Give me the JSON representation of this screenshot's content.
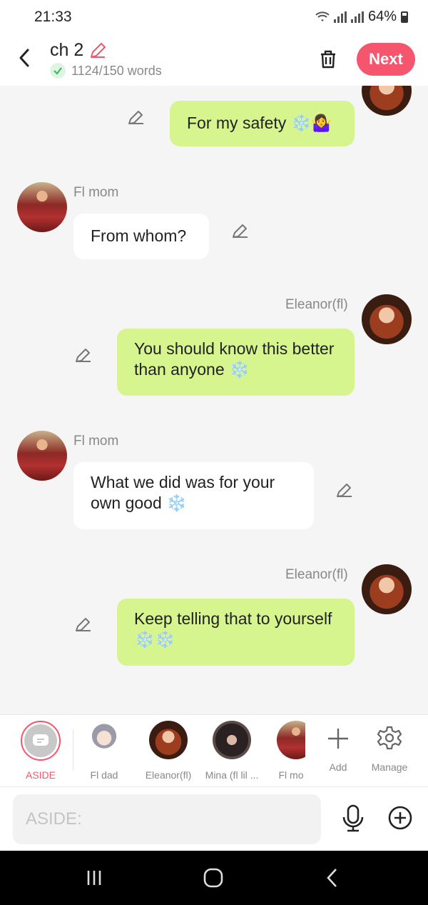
{
  "status": {
    "time": "21:33",
    "battery": "64%"
  },
  "header": {
    "title": "ch 2",
    "word_count": "1124/150 words",
    "next_label": "Next"
  },
  "messages": [
    {
      "id": "m1",
      "sender": "",
      "text": "For my safety ❄️🤷‍♀️",
      "side": "right"
    },
    {
      "id": "m2",
      "sender": "Fl mom",
      "text": "From whom?",
      "side": "left"
    },
    {
      "id": "m3",
      "sender": "Eleanor(fl)",
      "text": "You should know this better than anyone ❄️",
      "side": "right"
    },
    {
      "id": "m4",
      "sender": "Fl mom",
      "text": "What we did was for your own good ❄️",
      "side": "left"
    },
    {
      "id": "m5",
      "sender": "Eleanor(fl)",
      "text": "Keep telling that to yourself ❄️❄️",
      "side": "right"
    }
  ],
  "characters": [
    {
      "label": "ASIDE",
      "icon": "aside-icon"
    },
    {
      "label": "Fl dad",
      "icon": "fl-dad-avatar"
    },
    {
      "label": "Eleanor(fl)",
      "icon": "eleanor-avatar"
    },
    {
      "label": "Mina (fl lil ...",
      "icon": "mina-avatar"
    },
    {
      "label": "Fl mo",
      "icon": "fl-mom-avatar"
    },
    {
      "label": "Add",
      "icon": "plus-icon"
    },
    {
      "label": "Manage",
      "icon": "gear-icon"
    }
  ],
  "input": {
    "placeholder": "ASIDE:"
  },
  "colors": {
    "accent": "#f5556d",
    "bubble_green": "#d6f58e",
    "bubble_white": "#ffffff"
  }
}
